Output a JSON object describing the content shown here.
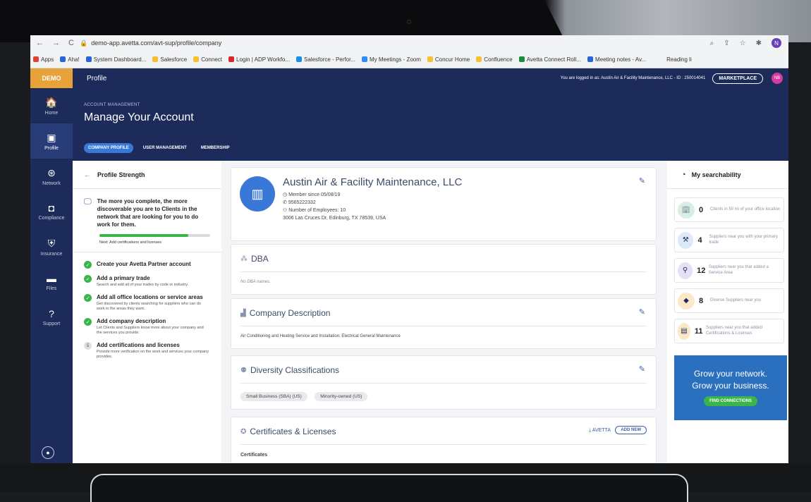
{
  "browser": {
    "url": "demo-app.avetta.com/avt-sup/profile/company",
    "profile_initial": "N",
    "bookmarks": [
      {
        "label": "Apps",
        "color": "#e34133"
      },
      {
        "label": "Aha!",
        "color": "#2a64d6"
      },
      {
        "label": "System Dashboard...",
        "color": "#2a64d6"
      },
      {
        "label": "Salesforce",
        "color": "#f2c230"
      },
      {
        "label": "Connect",
        "color": "#f2c230"
      },
      {
        "label": "Login | ADP Workfo...",
        "color": "#d02a2a"
      },
      {
        "label": "Salesforce - Perfor...",
        "color": "#1a8fe3"
      },
      {
        "label": "My Meetings - Zoom",
        "color": "#2d8cff"
      },
      {
        "label": "Concur Home",
        "color": "#f2c230"
      },
      {
        "label": "Confluence",
        "color": "#f2c230"
      },
      {
        "label": "Avetta Connect Roll...",
        "color": "#1d8a3e"
      },
      {
        "label": "Meeting notes - Av...",
        "color": "#2a64d6"
      }
    ],
    "reading_list": "Reading li"
  },
  "topbar": {
    "logo": "DEMO",
    "title": "Profile",
    "logged_in": "You are logged in as: Austin Air & Facility Maintenance, LLC - ID : 250014041",
    "marketplace": "MARKETPLACE",
    "avatar": "NB"
  },
  "sidebar": {
    "items": [
      {
        "label": "Home",
        "icon": "home-icon",
        "glyph": "🏠"
      },
      {
        "label": "Profile",
        "icon": "profile-icon",
        "glyph": "▣"
      },
      {
        "label": "Network",
        "icon": "network-icon",
        "glyph": "⊛"
      },
      {
        "label": "Compliance",
        "icon": "compliance-icon",
        "glyph": "◘"
      },
      {
        "label": "Insurance",
        "icon": "insurance-icon",
        "glyph": "⛨"
      },
      {
        "label": "Files",
        "icon": "files-icon",
        "glyph": "▬"
      },
      {
        "label": "Support",
        "icon": "support-icon",
        "glyph": "?"
      }
    ]
  },
  "header": {
    "breadcrumb": "ACCOUNT MANAGEMENT",
    "title": "Manage Your Account",
    "tabs": [
      "COMPANY PROFILE",
      "USER MANAGEMENT",
      "MEMBERSHIP"
    ]
  },
  "profile_strength": {
    "title": "Profile Strength",
    "intro": "The more you complete, the more discoverable you are to Clients in the network that are looking for you to do work for them.",
    "progress": 0.8,
    "next": "Next: Add certifications and licenses",
    "steps": [
      {
        "title": "Create your Avetta Partner account",
        "desc": "",
        "done": true
      },
      {
        "title": "Add a primary trade",
        "desc": "Search and add all of your trades by code or industry.",
        "done": true
      },
      {
        "title": "Add all office locations or service areas",
        "desc": "Get discovered by clients searching for suppliers who can do work in the areas they want.",
        "done": true
      },
      {
        "title": "Add company description",
        "desc": "Let Clients and Suppliers know more about your company and the services you provide.",
        "done": true
      },
      {
        "title": "Add certifications and licenses",
        "desc": "Provide more verification on the work and services your company provides.",
        "done": false,
        "num": "5"
      }
    ]
  },
  "company": {
    "name": "Austin Air & Facility Maintenance, LLC",
    "member_since": "Member since 05/08/19",
    "phone": "9565222332",
    "employees": "Number of Employees: 10",
    "address": "3006 Las Cruces Dr, Edinburg, TX 78539, USA"
  },
  "dba": {
    "title": "DBA",
    "empty": "No DBA names."
  },
  "description": {
    "title": "Company Description",
    "text": "Air Conditioning and Heating Service and Installation; Electrical General Maintenance"
  },
  "diversity": {
    "title": "Diversity Classifications",
    "tags": [
      "Small Business (SBA) (US)",
      "Minority-owned (US)"
    ]
  },
  "certificates": {
    "title": "Certificates & Licenses",
    "avetta": "AVETTA",
    "add_new": "ADD NEW",
    "sub": "Certificates"
  },
  "searchability": {
    "title": "My searchability",
    "items": [
      {
        "num": "0",
        "text": "Clients in 50 mi of your office location",
        "bg": "#d7efe4",
        "glyph": "🏢"
      },
      {
        "num": "4",
        "text": "Suppliers near you with your primary trade",
        "bg": "#dce9f8",
        "glyph": "⚒"
      },
      {
        "num": "12",
        "text": "Suppliers near you that added a Service Area",
        "bg": "#e6e0f4",
        "glyph": "⚲"
      },
      {
        "num": "8",
        "text": "Diverse Suppliers near you",
        "bg": "#fbe8c9",
        "glyph": "◆"
      },
      {
        "num": "11",
        "text": "Suppliers near you that added Certifications & Licenses",
        "bg": "#fbe8c9",
        "glyph": "▤"
      }
    ]
  },
  "promo": {
    "line1": "Grow your network.",
    "line2": "Grow your business.",
    "button": "FIND CONNECTIONS"
  }
}
